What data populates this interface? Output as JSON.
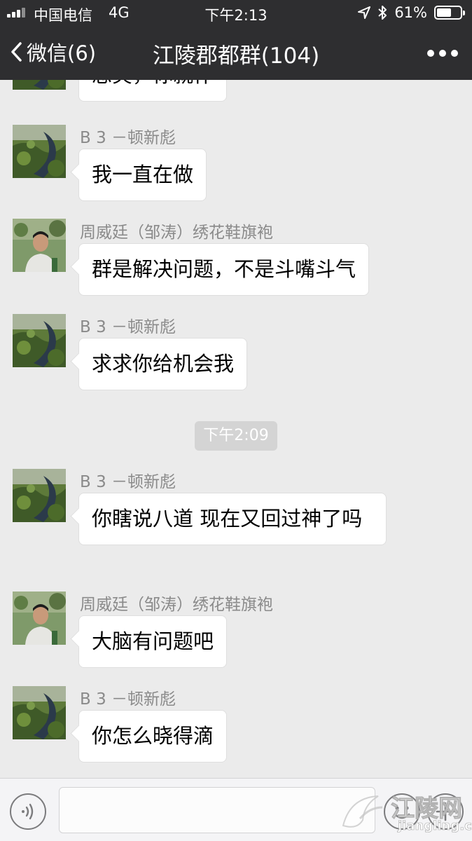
{
  "status_bar": {
    "carrier": "中国电信",
    "network": "4G",
    "time": "下午2:13",
    "battery_percent": "61%",
    "battery_level": 0.61,
    "icons": [
      "signal-icon",
      "location-icon",
      "bluetooth-icon",
      "battery-icon"
    ]
  },
  "nav": {
    "back_label": "微信(6)",
    "title": "江陵郡都群(104)",
    "more_icon": "more-dots-icon"
  },
  "messages": [
    {
      "sender": "",
      "text": "想笑，你就作",
      "avatar": "b3"
    },
    {
      "sender": "B 3 －顿新彪",
      "text": "我一直在做",
      "avatar": "b3"
    },
    {
      "sender": "周威廷（邹涛）绣花鞋旗袍",
      "text": "群是解决问题，不是斗嘴斗气",
      "avatar": "zhou"
    },
    {
      "sender": "B 3 －顿新彪",
      "text": "求求你给机会我",
      "avatar": "b3"
    },
    {
      "sender": "B 3 －顿新彪",
      "text": "你瞎说八道 现在又回过神了吗",
      "avatar": "b3"
    },
    {
      "sender": "周威廷（邹涛）绣花鞋旗袍",
      "text": "大脑有问题吧",
      "avatar": "zhou"
    },
    {
      "sender": "B 3 －顿新彪",
      "text": "你怎么晓得滴",
      "avatar": "b3"
    }
  ],
  "timestamp": "下午2:09",
  "input_bar": {
    "voice_icon": "voice-icon",
    "emoji_icon": "emoji-icon",
    "plus_icon": "plus-icon"
  },
  "watermark": {
    "title": "江陵网",
    "url": "jiangling.cn"
  },
  "colors": {
    "nav_bg": "#2e2e30",
    "chat_bg": "#ebebeb",
    "bubble_bg": "#ffffff",
    "sender_text": "#8a8a8a"
  }
}
